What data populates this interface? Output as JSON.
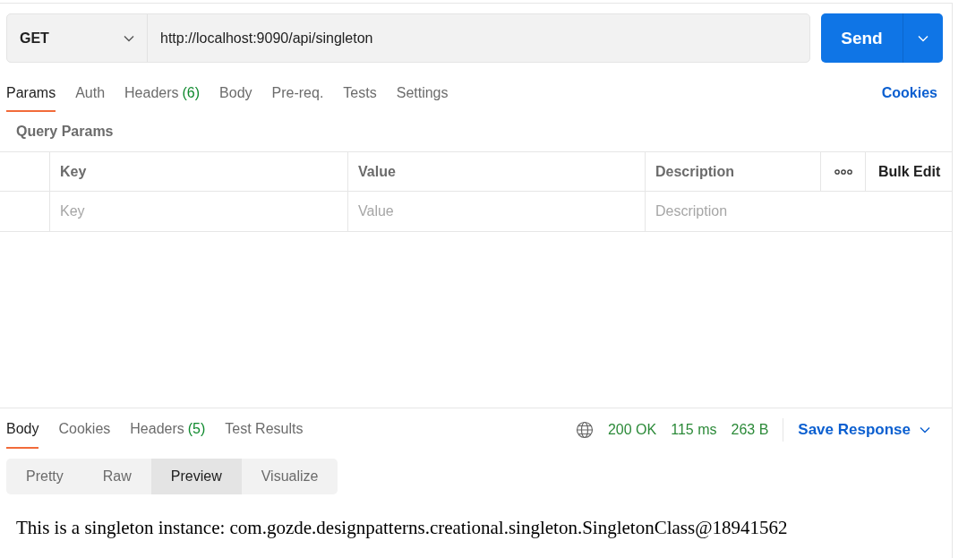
{
  "request": {
    "method": "GET",
    "url": "http://localhost:9090/api/singleton",
    "send_label": "Send"
  },
  "request_tabs": [
    {
      "label": "Params",
      "selected": true
    },
    {
      "label": "Auth",
      "selected": false
    },
    {
      "label": "Headers",
      "count": "(6)",
      "selected": false
    },
    {
      "label": "Body",
      "selected": false
    },
    {
      "label": "Pre-req.",
      "selected": false
    },
    {
      "label": "Tests",
      "selected": false
    },
    {
      "label": "Settings",
      "selected": false
    }
  ],
  "cookies_link": "Cookies",
  "query_params": {
    "title": "Query Params",
    "columns": [
      "Key",
      "Value",
      "Description"
    ],
    "bulk_edit": "Bulk Edit",
    "placeholders": [
      "Key",
      "Value",
      "Description"
    ]
  },
  "response": {
    "tabs": [
      {
        "label": "Body",
        "selected": true
      },
      {
        "label": "Cookies",
        "selected": false
      },
      {
        "label": "Headers",
        "count": "(5)",
        "selected": false
      },
      {
        "label": "Test Results",
        "selected": false
      }
    ],
    "status": "200 OK",
    "time": "115 ms",
    "size": "263 B",
    "save_label": "Save Response",
    "views": [
      {
        "label": "Pretty",
        "selected": false
      },
      {
        "label": "Raw",
        "selected": false
      },
      {
        "label": "Preview",
        "selected": true
      },
      {
        "label": "Visualize",
        "selected": false
      }
    ],
    "preview_text": "This is a singleton instance: com.gozde.designpatterns.creational.singleton.SingletonClass@18941562"
  }
}
